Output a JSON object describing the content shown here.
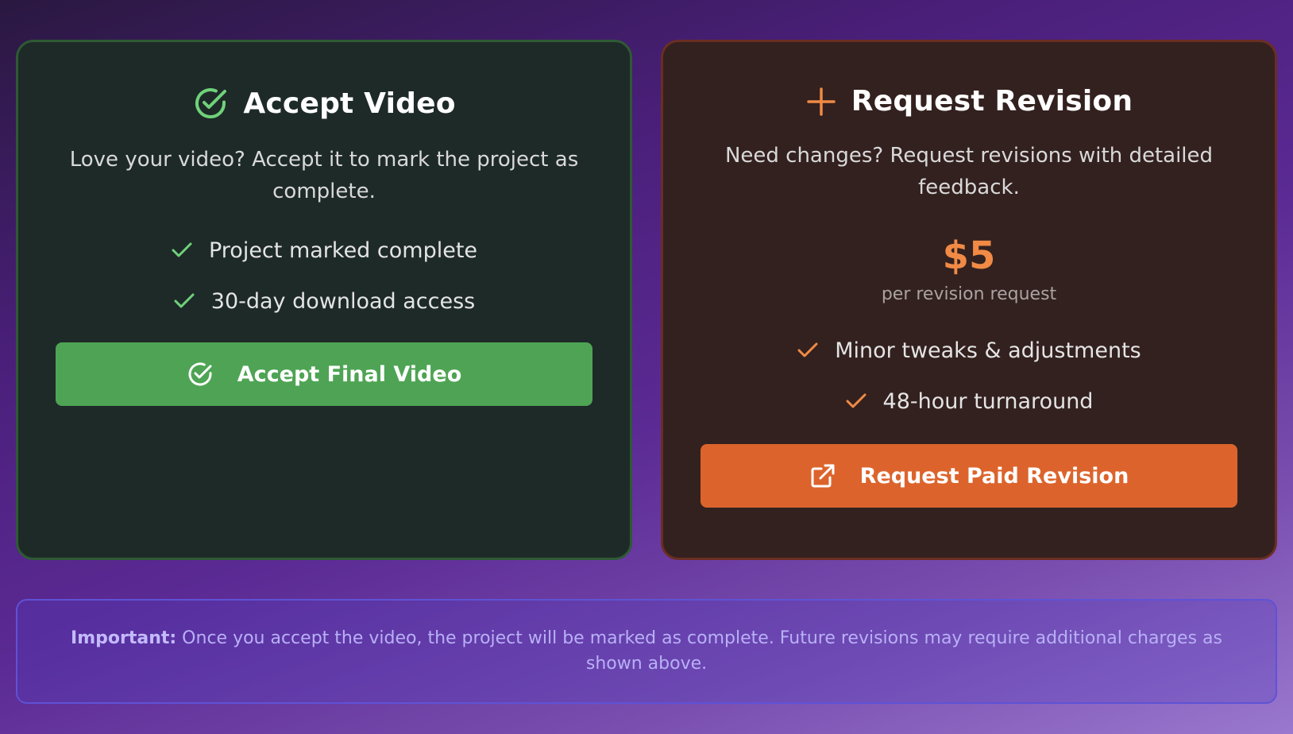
{
  "accept_card": {
    "title": "Accept Video",
    "title_icon": "check-circle-icon",
    "description": "Love your video? Accept it to mark the project as complete.",
    "features": [
      {
        "label": "Project marked complete",
        "icon": "check-icon"
      },
      {
        "label": "30-day download access",
        "icon": "check-icon"
      }
    ],
    "button": {
      "label": "Accept Final Video",
      "icon": "check-circle-icon"
    },
    "accent_color": "#4ea454",
    "icon_color": "#6fd27a"
  },
  "revision_card": {
    "title": "Request Revision",
    "title_icon": "plus-icon",
    "description": "Need changes? Request revisions with detailed feedback.",
    "price": "$5",
    "price_caption": "per revision request",
    "features": [
      {
        "label": "Minor tweaks & adjustments",
        "icon": "check-icon"
      },
      {
        "label": "48-hour turnaround",
        "icon": "check-icon"
      }
    ],
    "button": {
      "label": "Request Paid Revision",
      "icon": "external-link-icon"
    },
    "accent_color": "#dc642c",
    "icon_color": "#f08a45"
  },
  "notice": {
    "label": "Important:",
    "text": " Once you accept the video, the project will be marked as complete. Future revisions may require additional charges as shown above."
  }
}
